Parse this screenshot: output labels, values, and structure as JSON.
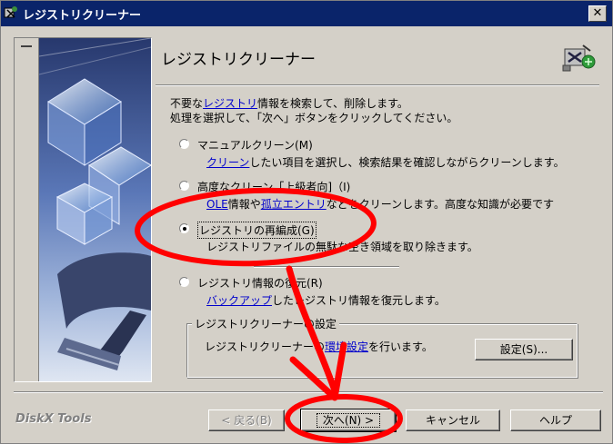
{
  "window": {
    "title": "レジストリクリーナー"
  },
  "header": {
    "title": "レジストリクリーナー"
  },
  "intro": {
    "line1_prefix": "不要な",
    "line1_link": "レジストリ",
    "line1_suffix": "情報を検索して、削除します。",
    "line2": "処理を選択して、「次へ」ボタンをクリックしてください。"
  },
  "options": [
    {
      "label": "マニュアルクリーン(M)",
      "desc_link": "クリーン",
      "desc_rest": "したい項目を選択し、検索結果を確認しながらクリーンします。",
      "selected": false
    },
    {
      "label": "高度なクリーン「上級者向]（I)",
      "desc_link": "OLE",
      "desc_mid": "情報や",
      "desc_link2": "孤立エントリ",
      "desc_rest": "などをクリーンします。高度な知識が必要です",
      "selected": false
    },
    {
      "label": "レジストリの再編成(G)",
      "desc_rest": "レジストリファイルの無駄な空き領域を取り除きます。",
      "selected": true
    },
    {
      "label": "レジストリ情報の復元(R)",
      "desc_link": "バックアップ",
      "desc_rest": "したレジストリ情報を復元します。",
      "selected": false
    }
  ],
  "settings_group": {
    "label": "レジストリクリーナーの設定",
    "text_prefix": "レジストリクリーナーの",
    "text_link": "環境設定",
    "text_suffix": "を行います。",
    "button": "設定(S)..."
  },
  "footer": {
    "brand": "DiskX Tools",
    "back": "< 戻る(B)",
    "next": "次へ(N) >",
    "cancel": "キャンセル",
    "help": "ヘルプ"
  },
  "colors": {
    "titlebar": "#0a246a",
    "face": "#d4d0c8",
    "link": "#0000cc",
    "annotation": "#ff0000"
  }
}
